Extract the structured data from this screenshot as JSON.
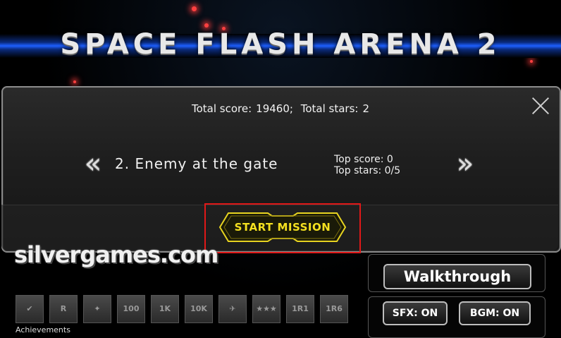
{
  "game_title": "SPACE FLASH ARENA 2",
  "dialog": {
    "total_score_label": "Total score:",
    "total_score": "19460;",
    "total_stars_label": "Total stars:",
    "total_stars": "2",
    "mission_name": "2. Enemy at the gate",
    "top_score_line": "Top score: 0",
    "top_stars_line": "Top stars: 0/5",
    "start_label": "START MISSION",
    "prev_glyph": "«",
    "next_glyph": "»"
  },
  "logo_text": "silvergames.com",
  "side": {
    "walkthrough_label": "Walkthrough",
    "sfx_label": "SFX: ON",
    "bgm_label": "BGM: ON"
  },
  "achievements": {
    "label": "Achievements",
    "badges": [
      "✔",
      "R",
      "✦",
      "100",
      "1K",
      "10K",
      "✈",
      "★★★",
      "1R1",
      "1R6"
    ]
  },
  "colors": {
    "accent": "#f4e020",
    "highlight": "#e01818",
    "stripe": "#1d5fff"
  }
}
